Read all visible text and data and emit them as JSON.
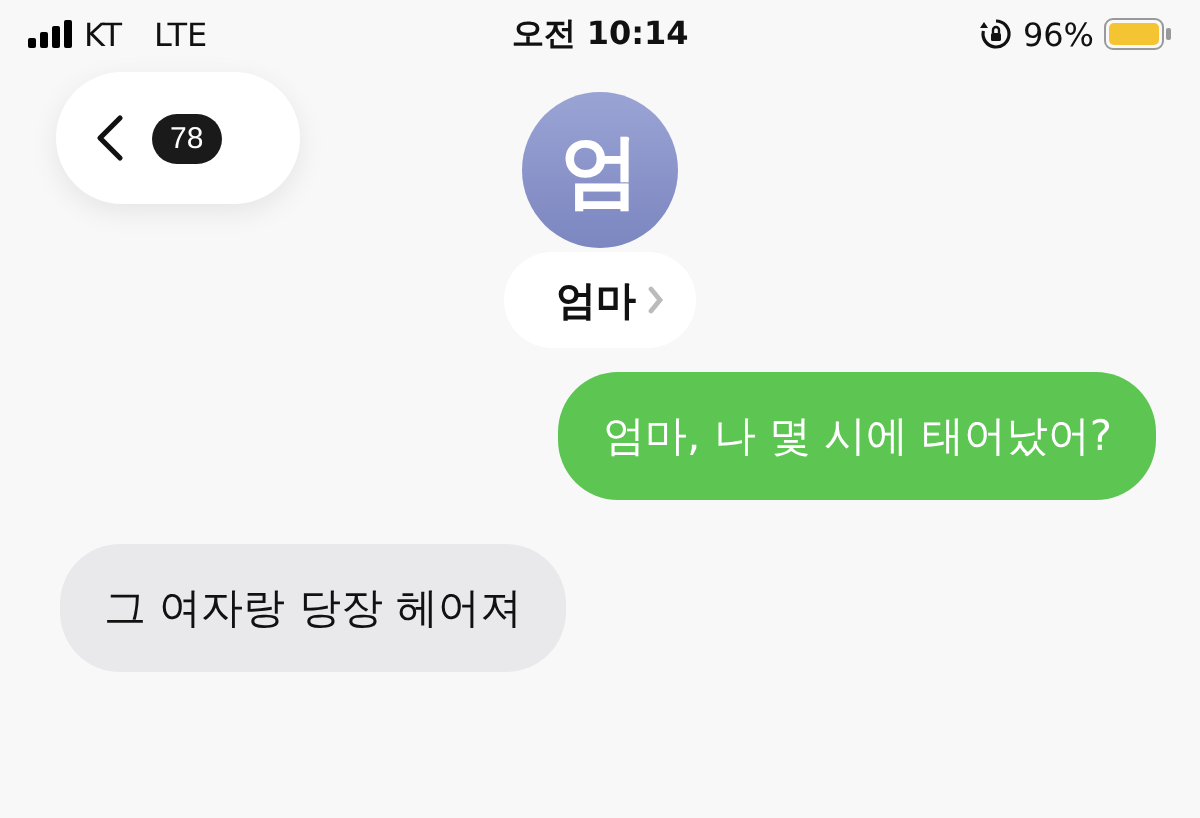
{
  "status_bar": {
    "carrier": "KT",
    "network": "LTE",
    "time": "오전 10:14",
    "battery": "96%"
  },
  "header": {
    "unread_count": "78",
    "avatar_initial": "엄",
    "contact_name": "엄마"
  },
  "messages": [
    {
      "kind": "sent",
      "text": "엄마, 나 몇 시에 태어났어?"
    },
    {
      "kind": "received",
      "text": "그 여자랑 당장 헤어져"
    }
  ]
}
